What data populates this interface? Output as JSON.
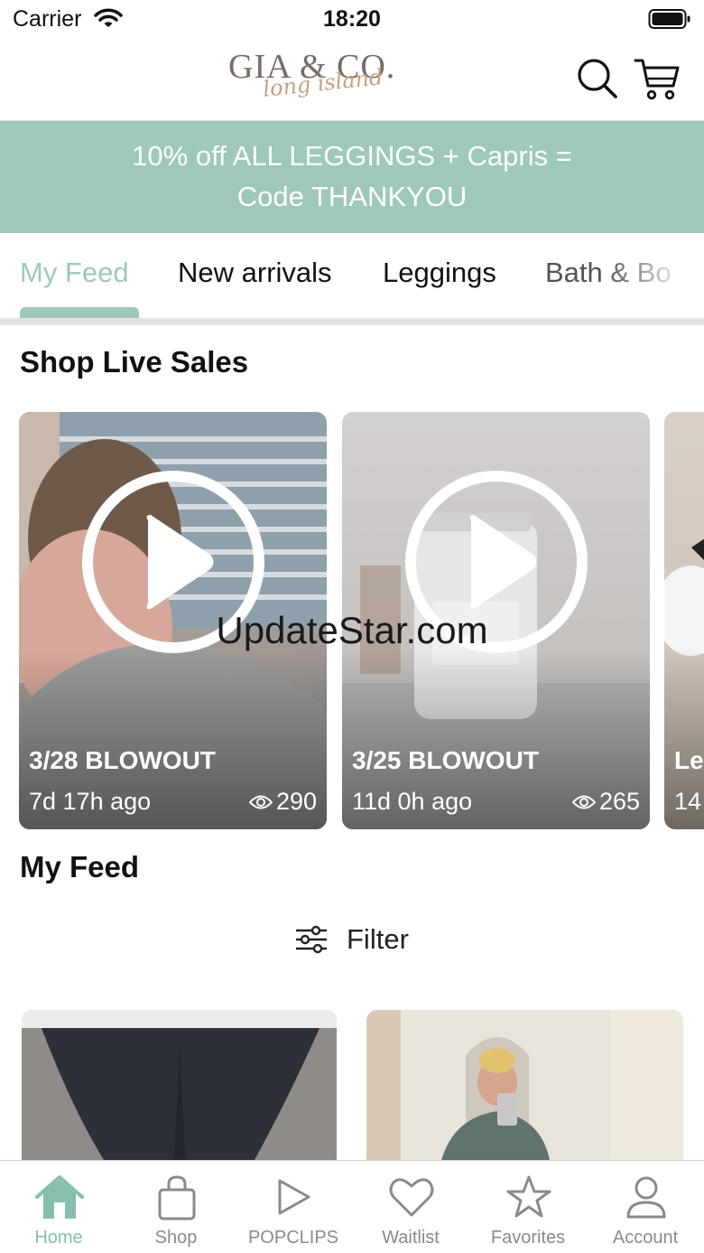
{
  "status_bar": {
    "carrier": "Carrier",
    "time": "18:20"
  },
  "header": {
    "logo_main": "GIA & CO.",
    "logo_script": "long island"
  },
  "banner": {
    "line1": "10% off ALL LEGGINGS + Capris =",
    "line2": "Code THANKYOU"
  },
  "tabs": [
    {
      "label": "My Feed",
      "active": true
    },
    {
      "label": "New arrivals"
    },
    {
      "label": "Leggings"
    },
    {
      "label": "Bath & Bo"
    }
  ],
  "live_sales": {
    "title": "Shop Live Sales",
    "cards": [
      {
        "title": "3/28 BLOWOUT",
        "ago": "7d 17h ago",
        "views": "290"
      },
      {
        "title": "3/25 BLOWOUT",
        "ago": "11d 0h ago",
        "views": "265"
      },
      {
        "title": "Le",
        "ago": "14"
      }
    ]
  },
  "feed": {
    "title": "My Feed",
    "filter_label": "Filter"
  },
  "watermark": "UpdateStar.com",
  "bottom_nav": [
    {
      "label": "Home",
      "icon": "home-icon",
      "active": true
    },
    {
      "label": "Shop",
      "icon": "shopping-bag-icon"
    },
    {
      "label": "POPCLIPS",
      "icon": "play-icon"
    },
    {
      "label": "Waitlist",
      "icon": "heart-icon"
    },
    {
      "label": "Favorites",
      "icon": "star-icon"
    },
    {
      "label": "Account",
      "icon": "person-icon"
    }
  ],
  "colors": {
    "accent": "#9ec8ba",
    "nav_active": "#86bfae",
    "nav_inactive": "#8a8a8a"
  }
}
